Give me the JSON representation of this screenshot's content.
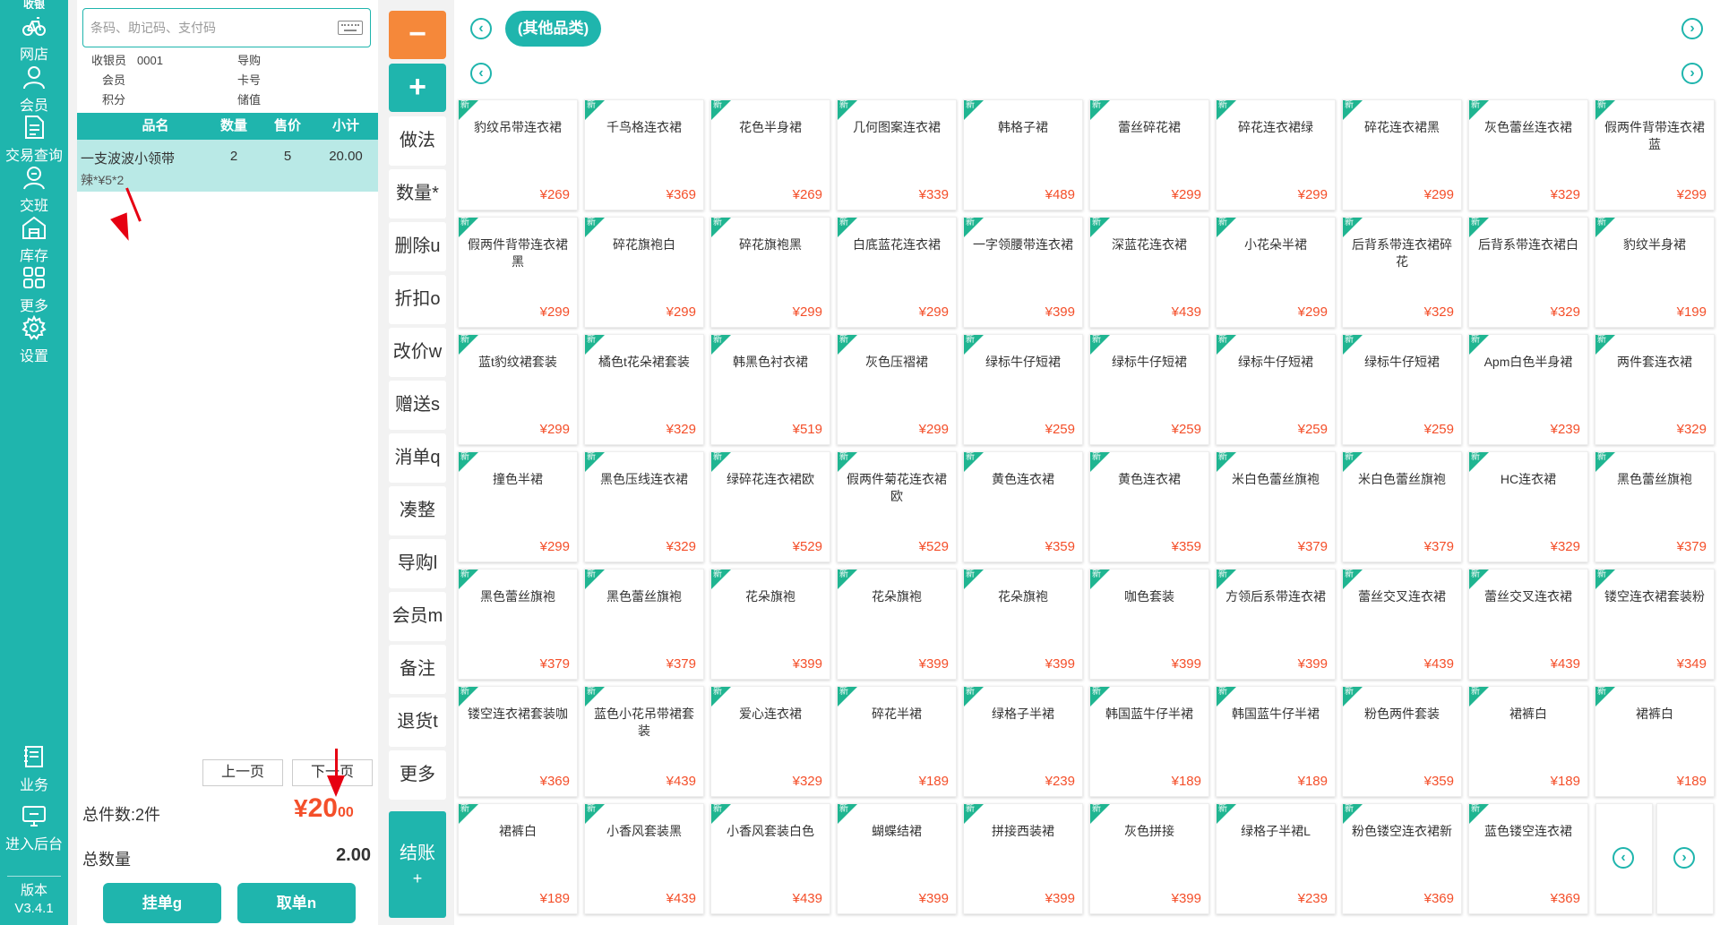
{
  "nav": {
    "top_label": "收银",
    "items": [
      {
        "label": "网店",
        "icon": "bicycle-icon"
      },
      {
        "label": "会员",
        "icon": "user-icon"
      },
      {
        "label": "交易查询",
        "icon": "document-icon"
      },
      {
        "label": "交班",
        "icon": "shift-icon"
      },
      {
        "label": "库存",
        "icon": "warehouse-icon"
      },
      {
        "label": "更多",
        "icon": "grid-icon"
      },
      {
        "label": "设置",
        "icon": "gear-icon"
      },
      {
        "label": "业务",
        "icon": "book-icon"
      },
      {
        "label": "进入后台",
        "icon": "monitor-icon"
      }
    ],
    "version_label": "版本",
    "version": "V3.4.1"
  },
  "cart": {
    "search_placeholder": "条码、助记码、支付码",
    "info": {
      "cashier_label": "收银员",
      "cashier_value": "0001",
      "guide_label": "导购",
      "member_label": "会员",
      "card_label": "卡号",
      "points_label": "积分",
      "stored_label": "储值"
    },
    "headers": [
      "品名",
      "数量",
      "售价",
      "小计"
    ],
    "rows": [
      {
        "name": "一支波波小领带",
        "qty": "2",
        "price": "5",
        "subtotal": "20.00",
        "note": "辣*¥5*2"
      }
    ],
    "prev_page": "上一页",
    "next_page": "下一页",
    "total_items_label": "总件数:2件",
    "amount_currency": "¥",
    "amount_int": "20",
    "amount_dec": "00",
    "total_qty_label": "总数量",
    "total_qty": "2.00",
    "hang_button": "挂单g",
    "retrieve_button": "取单n"
  },
  "ops": {
    "minus": "−",
    "plus": "+",
    "buttons": [
      "做法",
      "数量*",
      "删除u",
      "折扣o",
      "改价w",
      "赠送s",
      "消单q",
      "凑整",
      "导购l",
      "会员m",
      "备注",
      "退货t",
      "更多"
    ],
    "checkout": "结账",
    "checkout_sub": "+"
  },
  "catalog": {
    "category": "(其他品类)",
    "new_badge": "新",
    "products": [
      {
        "name": "豹纹吊带连衣裙",
        "price": "¥269"
      },
      {
        "name": "千鸟格连衣裙",
        "price": "¥369"
      },
      {
        "name": "花色半身裙",
        "price": "¥269"
      },
      {
        "name": "几何图案连衣裙",
        "price": "¥339"
      },
      {
        "name": "韩格子裙",
        "price": "¥489"
      },
      {
        "name": "蕾丝碎花裙",
        "price": "¥299"
      },
      {
        "name": "碎花连衣裙绿",
        "price": "¥299"
      },
      {
        "name": "碎花连衣裙黑",
        "price": "¥299"
      },
      {
        "name": "灰色蕾丝连衣裙",
        "price": "¥329"
      },
      {
        "name": "假两件背带连衣裙蓝",
        "price": "¥299"
      },
      {
        "name": "假两件背带连衣裙黑",
        "price": "¥299"
      },
      {
        "name": "碎花旗袍白",
        "price": "¥299"
      },
      {
        "name": "碎花旗袍黑",
        "price": "¥299"
      },
      {
        "name": "白底蓝花连衣裙",
        "price": "¥299"
      },
      {
        "name": "一字领腰带连衣裙",
        "price": "¥399"
      },
      {
        "name": "深蓝花连衣裙",
        "price": "¥439"
      },
      {
        "name": "小花朵半裙",
        "price": "¥299"
      },
      {
        "name": "后背系带连衣裙碎花",
        "price": "¥329"
      },
      {
        "name": "后背系带连衣裙白",
        "price": "¥329"
      },
      {
        "name": "豹纹半身裙",
        "price": "¥199"
      },
      {
        "name": "蓝t豹纹裙套装",
        "price": "¥299"
      },
      {
        "name": "橘色t花朵裙套装",
        "price": "¥329"
      },
      {
        "name": "韩黑色衬衣裙",
        "price": "¥519"
      },
      {
        "name": "灰色压褶裙",
        "price": "¥299"
      },
      {
        "name": "绿标牛仔短裙",
        "price": "¥259"
      },
      {
        "name": "绿标牛仔短裙",
        "price": "¥259"
      },
      {
        "name": "绿标牛仔短裙",
        "price": "¥259"
      },
      {
        "name": "绿标牛仔短裙",
        "price": "¥259"
      },
      {
        "name": "Apm白色半身裙",
        "price": "¥239"
      },
      {
        "name": "两件套连衣裙",
        "price": "¥329"
      },
      {
        "name": "撞色半裙",
        "price": "¥299"
      },
      {
        "name": "黑色压线连衣裙",
        "price": "¥329"
      },
      {
        "name": "绿碎花连衣裙欧",
        "price": "¥529"
      },
      {
        "name": "假两件菊花连衣裙欧",
        "price": "¥529"
      },
      {
        "name": "黄色连衣裙",
        "price": "¥359"
      },
      {
        "name": "黄色连衣裙",
        "price": "¥359"
      },
      {
        "name": "米白色蕾丝旗袍",
        "price": "¥379"
      },
      {
        "name": "米白色蕾丝旗袍",
        "price": "¥379"
      },
      {
        "name": "HC连衣裙",
        "price": "¥329"
      },
      {
        "name": "黑色蕾丝旗袍",
        "price": "¥379"
      },
      {
        "name": "黑色蕾丝旗袍",
        "price": "¥379"
      },
      {
        "name": "黑色蕾丝旗袍",
        "price": "¥379"
      },
      {
        "name": "花朵旗袍",
        "price": "¥399"
      },
      {
        "name": "花朵旗袍",
        "price": "¥399"
      },
      {
        "name": "花朵旗袍",
        "price": "¥399"
      },
      {
        "name": "咖色套装",
        "price": "¥399"
      },
      {
        "name": "方领后系带连衣裙",
        "price": "¥399"
      },
      {
        "name": "蕾丝交叉连衣裙",
        "price": "¥439"
      },
      {
        "name": "蕾丝交叉连衣裙",
        "price": "¥439"
      },
      {
        "name": "镂空连衣裙套装粉",
        "price": "¥349"
      },
      {
        "name": "镂空连衣裙套装咖",
        "price": "¥369"
      },
      {
        "name": "蓝色小花吊带裙套装",
        "price": "¥439"
      },
      {
        "name": "爱心连衣裙",
        "price": "¥329"
      },
      {
        "name": "碎花半裙",
        "price": "¥189"
      },
      {
        "name": "绿格子半裙",
        "price": "¥239"
      },
      {
        "name": "韩国蓝牛仔半裙",
        "price": "¥189"
      },
      {
        "name": "韩国蓝牛仔半裙",
        "price": "¥189"
      },
      {
        "name": "粉色两件套装",
        "price": "¥359"
      },
      {
        "name": "裙裤白",
        "price": "¥189"
      },
      {
        "name": "裙裤白",
        "price": "¥189"
      },
      {
        "name": "裙裤白",
        "price": "¥189"
      },
      {
        "name": "小香风套装黑",
        "price": "¥439"
      },
      {
        "name": "小香风套装白色",
        "price": "¥439"
      },
      {
        "name": "蝴蝶结裙",
        "price": "¥399"
      },
      {
        "name": "拼接西装裙",
        "price": "¥399"
      },
      {
        "name": "灰色拼接",
        "price": "¥399"
      },
      {
        "name": "绿格子半裙L",
        "price": "¥239"
      },
      {
        "name": "粉色镂空连衣裙新",
        "price": "¥369"
      },
      {
        "name": "蓝色镂空连衣裙",
        "price": "¥369"
      }
    ]
  },
  "colors": {
    "accent": "#1fb5ad",
    "orange": "#f5883a",
    "price": "#f44f2a",
    "annotation": "#e60012"
  }
}
